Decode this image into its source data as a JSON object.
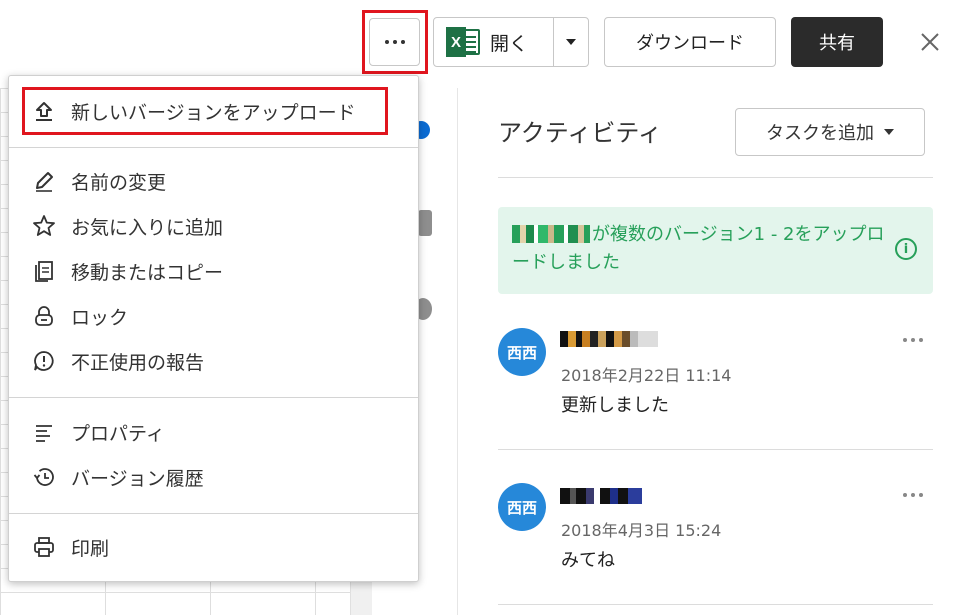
{
  "toolbar": {
    "more_icon": "more-horizontal-icon",
    "open_label": "開く",
    "excel_letter": "X",
    "download_label": "ダウンロード",
    "share_label": "共有",
    "close_icon": "close-icon"
  },
  "menu": {
    "items": [
      {
        "label": "新しいバージョンをアップロード",
        "icon": "upload-icon"
      },
      {
        "label": "名前の変更",
        "icon": "pencil-icon"
      },
      {
        "label": "お気に入りに追加",
        "icon": "star-icon"
      },
      {
        "label": "移動またはコピー",
        "icon": "copy-icon"
      },
      {
        "label": "ロック",
        "icon": "lock-icon"
      },
      {
        "label": "不正使用の報告",
        "icon": "report-icon"
      },
      {
        "label": "プロパティ",
        "icon": "properties-icon"
      },
      {
        "label": "バージョン履歴",
        "icon": "history-icon"
      },
      {
        "label": "印刷",
        "icon": "printer-icon"
      }
    ]
  },
  "activity": {
    "title": "アクティビティ",
    "task_button": "タスクを追加",
    "notice": "が複数のバージョン1 - 2をアップロードしました",
    "entries": [
      {
        "avatar": "西西",
        "time": "2018年2月22日 11:14",
        "text": "更新しました"
      },
      {
        "avatar": "西西",
        "time": "2018年4月3日 15:24",
        "text": "みてね"
      }
    ]
  },
  "colors": {
    "highlight": "#e0151e",
    "share_bg": "#2b2b2b",
    "notice_bg": "#e3f5ec",
    "notice_text": "#27a05a",
    "avatar_bg": "#2688d9",
    "excel_green": "#1e7145"
  }
}
